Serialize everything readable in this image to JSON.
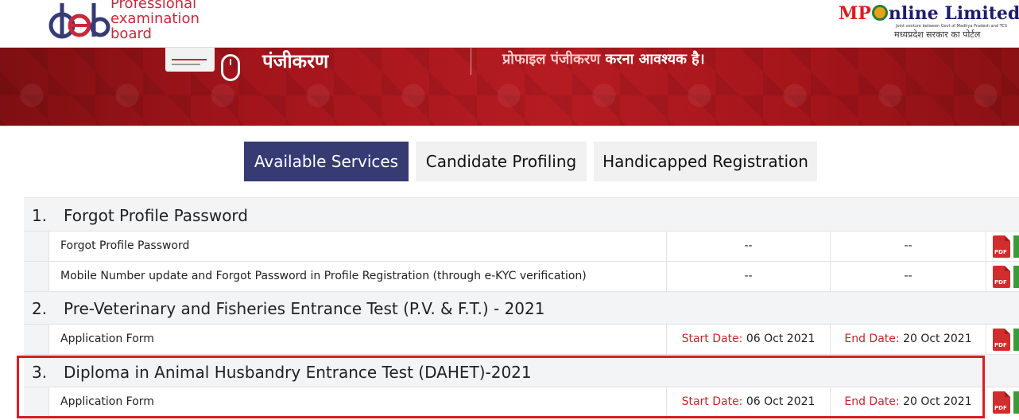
{
  "header": {
    "peb_logo_text": [
      "Professional",
      "examination",
      "board"
    ],
    "mp_logo": {
      "brand_prefix": "MP",
      "brand_rest": "nline Limited",
      "tagline": "Joint venture between Govt of Madhya Pradesh and TCS",
      "hindi_tagline": "मध्यप्रदेश सरकार का पोर्टल"
    }
  },
  "banner": {
    "title": "पंजीकरण",
    "message_highlight": "प्रोफाइल पंजीकरण",
    "message_rest": "करना आवश्यक है।"
  },
  "tabs": [
    {
      "label": "Available Services",
      "active": true
    },
    {
      "label": "Candidate Profiling",
      "active": false
    },
    {
      "label": "Handicapped Registration",
      "active": false
    }
  ],
  "labels": {
    "start": "Start Date:",
    "end": "End Date:",
    "pdf": "PDF"
  },
  "sections": [
    {
      "num": "1.",
      "title": "Forgot Profile Password",
      "rows": [
        {
          "name": "Forgot Profile Password",
          "start": "--",
          "end": "--"
        },
        {
          "name": "Mobile Number update and Forgot Password in Profile Registration (through e-KYC verification)",
          "start": "--",
          "end": "--"
        }
      ]
    },
    {
      "num": "2.",
      "title": "Pre-Veterinary and Fisheries Entrance Test (P.V. & F.T.) - 2021",
      "rows": [
        {
          "name": "Application Form",
          "start": "06 Oct 2021",
          "end": "20 Oct 2021"
        }
      ]
    },
    {
      "num": "3.",
      "title": "Diploma in Animal Husbandry Entrance Test (DAHET)-2021",
      "rows": [
        {
          "name": "Application Form",
          "start": "06 Oct 2021",
          "end": "20 Oct 2021"
        }
      ]
    }
  ],
  "colors": {
    "tab_active": "#363b74",
    "date_label": "#c0272d",
    "highlight_border": "#d91d25",
    "banner": "#b51c22"
  }
}
